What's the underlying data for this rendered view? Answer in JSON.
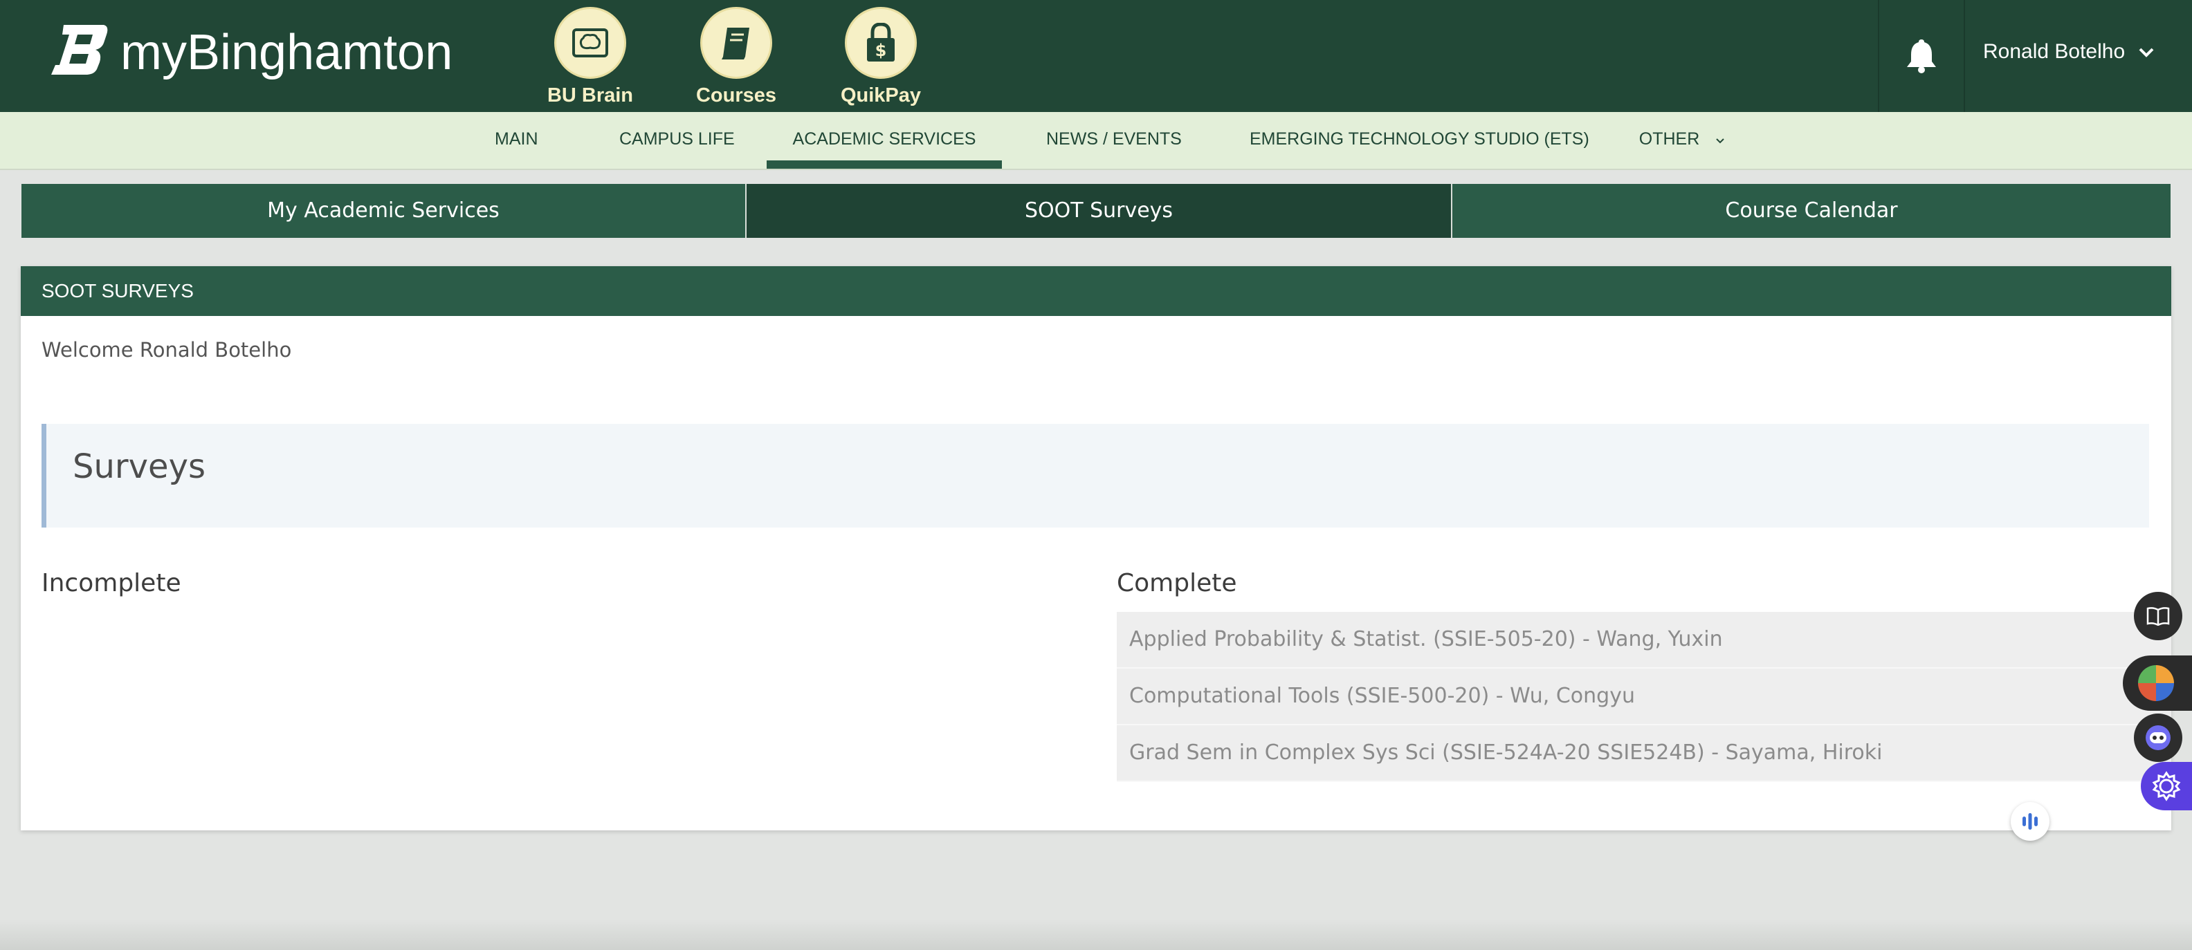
{
  "header": {
    "brand": "myBinghamton",
    "apps": [
      {
        "label": "BU Brain",
        "icon": "brain-icon"
      },
      {
        "label": "Courses",
        "icon": "book-icon"
      },
      {
        "label": "QuikPay",
        "icon": "lock-dollar-icon"
      }
    ],
    "user_name": "Ronald Botelho"
  },
  "nav": {
    "items": [
      "MAIN",
      "CAMPUS LIFE",
      "ACADEMIC SERVICES",
      "NEWS / EVENTS",
      "EMERGING TECHNOLOGY STUDIO (ETS)",
      "OTHER"
    ],
    "active": "ACADEMIC SERVICES"
  },
  "tabs": [
    "My Academic Services",
    "SOOT Surveys",
    "Course Calendar"
  ],
  "selected_tab": "SOOT Surveys",
  "card": {
    "title": "SOOT SURVEYS",
    "welcome": "Welcome Ronald Botelho",
    "surveys_heading": "Surveys",
    "incomplete_heading": "Incomplete",
    "complete_heading": "Complete",
    "complete_items": [
      "Applied Probability & Statist. (SSIE-505-20) - Wang, Yuxin",
      "Computational Tools (SSIE-500-20) - Wu, Congyu",
      "Grad Sem in Complex Sys Sci (SSIE-524A-20 SSIE524B) - Sayama, Hiroki"
    ]
  },
  "colors": {
    "header_bg": "#214736",
    "nav_bg": "#e3efd9",
    "tab_bg": "#2b5c48",
    "tab_selected_bg": "#1f4334",
    "app_icon_bg": "#f6f0c6"
  }
}
